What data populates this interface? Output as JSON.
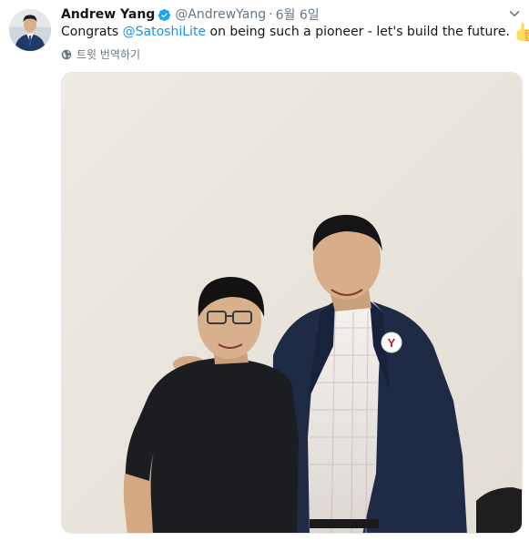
{
  "tweet": {
    "author": {
      "name": "Andrew Yang",
      "handle": "@AndrewYang",
      "verified": true
    },
    "separator": "·",
    "timestamp": "6월 6일",
    "text": {
      "before": "Congrats ",
      "mention": "@SatoshiLite",
      "after": " on being such a pioneer - let's build the future.",
      "emoji": "thumbs-up"
    },
    "translate_label": "트윗 번역하기",
    "photo": {
      "description": "two men posing together in front of a white wall",
      "pin_letter": "Y"
    }
  },
  "colors": {
    "accent": "#1b95e0",
    "secondary_text": "#657786",
    "primary_text": "#14171a",
    "verified": "#1da1f2"
  }
}
